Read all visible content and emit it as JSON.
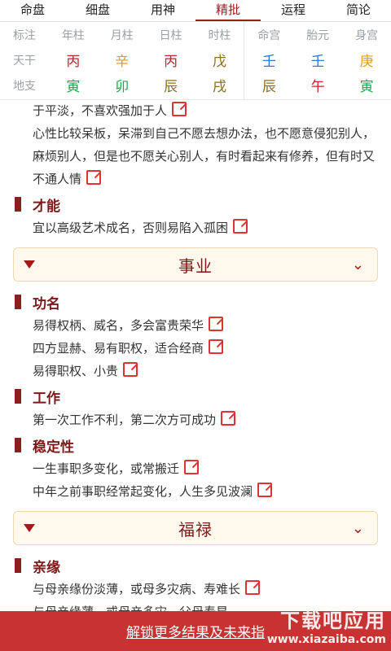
{
  "tabs": [
    "命盘",
    "细盘",
    "用神",
    "精批",
    "运程",
    "简论"
  ],
  "pillars": {
    "headers_left": [
      "标注",
      "年柱",
      "月柱",
      "日柱",
      "时柱"
    ],
    "headers_right": [
      "命宫",
      "胎元",
      "身宫"
    ],
    "tiangan_label": "天干",
    "dizhi_label": "地支",
    "tiangan_left": [
      {
        "t": "丙",
        "c": "red"
      },
      {
        "t": "辛",
        "c": "orange"
      },
      {
        "t": "丙",
        "c": "red"
      },
      {
        "t": "戊",
        "c": "brown"
      }
    ],
    "dizhi_left": [
      {
        "t": "寅",
        "c": "green"
      },
      {
        "t": "卯",
        "c": "green"
      },
      {
        "t": "辰",
        "c": "brown"
      },
      {
        "t": "戌",
        "c": "brown"
      }
    ],
    "tiangan_right": [
      {
        "t": "壬",
        "c": "blue"
      },
      {
        "t": "壬",
        "c": "blue"
      },
      {
        "t": "庚",
        "c": "orange"
      }
    ],
    "dizhi_right": [
      {
        "t": "辰",
        "c": "brown"
      },
      {
        "t": "午",
        "c": "red"
      },
      {
        "t": "寅",
        "c": "green"
      }
    ]
  },
  "content": {
    "line1": "于平淡，不喜欢强加于人",
    "para1": "心性比较呆板，呆滞到自己不愿去想办法，也不愿意侵犯别人，麻烦别人，但是也不愿关心别人，有时看起来有修养，但有时又不通人情",
    "talent_title": "才能",
    "talent_text": "宜以高级艺术成名，否则易陷入孤困",
    "career_panel": "事业",
    "gongming_title": "功名",
    "gongming_items": [
      "易得权柄、威名，多会富贵荣华",
      "四方显赫、易有职权，适合经商",
      "易得职权、小贵"
    ],
    "work_title": "工作",
    "work_text": "第一次工作不利，第二次方可成功",
    "stability_title": "稳定性",
    "stability_items": [
      "一生事职多变化，或常搬迁",
      "中年之前事职经常起变化，人生多见波澜"
    ],
    "fortune_panel": "福禄",
    "family_title": "亲缘",
    "family_items": [
      "与母亲缘份淡薄，或母多灾病、寿难长",
      "与母亲缘薄、或母亲多灾、父母寿星"
    ]
  },
  "footer": {
    "unlock": "解锁更多结果及未来指",
    "watermark_top": "下载吧应用",
    "watermark_bottom": "www.xiazaiba.com"
  },
  "colors": {
    "accent": "#9b1b1b",
    "footer": "#c83232"
  }
}
